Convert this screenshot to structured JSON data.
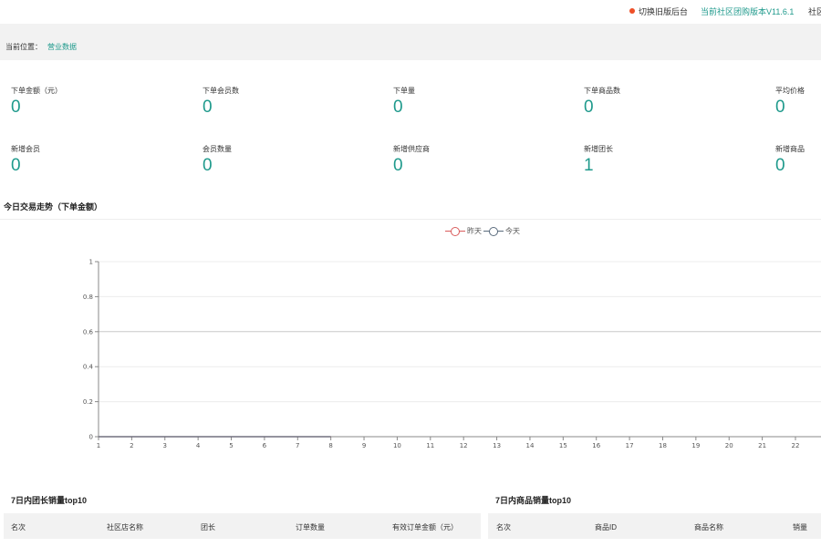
{
  "topbar": {
    "switch_label": "切换旧版后台",
    "version_label": "当前社区团购版本V11.6.1",
    "more_label": "社区"
  },
  "breadcrumb": {
    "label": "当前位置：",
    "current": "营业数据"
  },
  "stats": [
    {
      "title": "下单金额（元）",
      "value": "0"
    },
    {
      "title": "下单会员数",
      "value": "0"
    },
    {
      "title": "下单量",
      "value": "0"
    },
    {
      "title": "下单商品数",
      "value": "0"
    },
    {
      "title": "平均价格",
      "value": "0"
    },
    {
      "title": "新增会员",
      "value": "0"
    },
    {
      "title": "会员数量",
      "value": "0"
    },
    {
      "title": "新增供应商",
      "value": "0"
    },
    {
      "title": "新增团长",
      "value": "1"
    },
    {
      "title": "新增商品",
      "value": "0"
    }
  ],
  "trend_section": {
    "title": "今日交易走势（下单金额）"
  },
  "chart_data": {
    "type": "line",
    "title": "",
    "xlabel": "",
    "ylabel": "",
    "x": [
      1,
      2,
      3,
      4,
      5,
      6,
      7,
      8,
      9,
      10,
      11,
      12,
      13,
      14,
      15,
      16,
      17,
      18,
      19,
      20,
      21,
      22
    ],
    "x_tick_labels": [
      "1",
      "2",
      "3",
      "4",
      "5",
      "6",
      "7",
      "8",
      "9",
      "10",
      "11",
      "12",
      "13",
      "14",
      "15",
      "16",
      "17",
      "18",
      "19",
      "20",
      "21",
      "22"
    ],
    "y_tick_labels": [
      "0",
      "0.2",
      "0.4",
      "0.6",
      "0.8",
      "1"
    ],
    "ylim": [
      0,
      1
    ],
    "grid": true,
    "legend_position": "top-center",
    "series": [
      {
        "name": "昨天",
        "color": "#d95c5c",
        "x": [
          1,
          2,
          3,
          4,
          5,
          6,
          7,
          8
        ],
        "values": [
          0,
          0,
          0,
          0,
          0,
          0,
          0,
          0
        ]
      },
      {
        "name": "今天",
        "color": "#5a6b7d",
        "x": [
          1,
          2,
          3,
          4,
          5,
          6,
          7,
          8
        ],
        "values": [
          0,
          0,
          0,
          0,
          0,
          0,
          0,
          0
        ]
      }
    ]
  },
  "leader_table": {
    "title": "7日内团长销量top10",
    "columns": [
      "名次",
      "社区店名称",
      "团长",
      "订单数量",
      "有效订单金额（元）"
    ]
  },
  "goods_table": {
    "title": "7日内商品销量top10",
    "columns": [
      "名次",
      "商品ID",
      "商品名称",
      "销量"
    ]
  }
}
